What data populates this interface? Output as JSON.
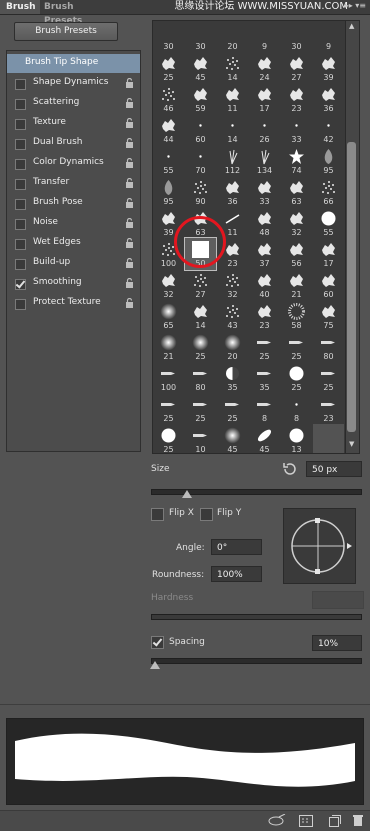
{
  "tabs": {
    "brush": "Brush",
    "brush_presets": "Brush Presets"
  },
  "watermark": "思缘设计论坛 WWW.MISSYUAN.COM",
  "brush_presets_button": "Brush Presets",
  "options": [
    {
      "label": "Brush Tip Shape",
      "selected": true,
      "checkbox": false,
      "checked": false,
      "lock": false
    },
    {
      "label": "Shape Dynamics",
      "checkbox": true,
      "checked": false,
      "lock": true
    },
    {
      "label": "Scattering",
      "checkbox": true,
      "checked": false,
      "lock": true
    },
    {
      "label": "Texture",
      "checkbox": true,
      "checked": false,
      "lock": true
    },
    {
      "label": "Dual Brush",
      "checkbox": true,
      "checked": false,
      "lock": true
    },
    {
      "label": "Color Dynamics",
      "checkbox": true,
      "checked": false,
      "lock": true
    },
    {
      "label": "Transfer",
      "checkbox": true,
      "checked": false,
      "lock": true
    },
    {
      "label": "Brush Pose",
      "checkbox": true,
      "checked": false,
      "lock": true
    },
    {
      "label": "Noise",
      "checkbox": true,
      "checked": false,
      "lock": true
    },
    {
      "label": "Wet Edges",
      "checkbox": true,
      "checked": false,
      "lock": true
    },
    {
      "label": "Build-up",
      "checkbox": true,
      "checked": false,
      "lock": true
    },
    {
      "label": "Smoothing",
      "checkbox": true,
      "checked": true,
      "lock": true
    },
    {
      "label": "Protect Texture",
      "checkbox": true,
      "checked": false,
      "lock": true
    }
  ],
  "tips": [
    {
      "n": "30",
      "s": "none"
    },
    {
      "n": "30",
      "s": "none"
    },
    {
      "n": "20",
      "s": "none"
    },
    {
      "n": "9",
      "s": "none"
    },
    {
      "n": "30",
      "s": "none"
    },
    {
      "n": "9",
      "s": "none"
    },
    {
      "n": "25",
      "s": "splat"
    },
    {
      "n": "45",
      "s": "splat"
    },
    {
      "n": "14",
      "s": "dots"
    },
    {
      "n": "24",
      "s": "splat"
    },
    {
      "n": "27",
      "s": "splat"
    },
    {
      "n": "39",
      "s": "splat"
    },
    {
      "n": "46",
      "s": "dots"
    },
    {
      "n": "59",
      "s": "splat"
    },
    {
      "n": "11",
      "s": "splat"
    },
    {
      "n": "17",
      "s": "splat"
    },
    {
      "n": "23",
      "s": "splat"
    },
    {
      "n": "36",
      "s": "splat"
    },
    {
      "n": "44",
      "s": "splat"
    },
    {
      "n": "60",
      "s": "dot"
    },
    {
      "n": "14",
      "s": "dot"
    },
    {
      "n": "26",
      "s": "dot"
    },
    {
      "n": "33",
      "s": "dot"
    },
    {
      "n": "42",
      "s": "dot"
    },
    {
      "n": "55",
      "s": "dot"
    },
    {
      "n": "70",
      "s": "dot"
    },
    {
      "n": "112",
      "s": "grass"
    },
    {
      "n": "134",
      "s": "grass"
    },
    {
      "n": "74",
      "s": "star"
    },
    {
      "n": "95",
      "s": "leaf"
    },
    {
      "n": "95",
      "s": "leaf"
    },
    {
      "n": "90",
      "s": "dots"
    },
    {
      "n": "36",
      "s": "splat"
    },
    {
      "n": "33",
      "s": "splat"
    },
    {
      "n": "63",
      "s": "splat"
    },
    {
      "n": "66",
      "s": "dots"
    },
    {
      "n": "39",
      "s": "splat"
    },
    {
      "n": "63",
      "s": "splat"
    },
    {
      "n": "11",
      "s": "stroke"
    },
    {
      "n": "48",
      "s": "splat"
    },
    {
      "n": "32",
      "s": "splat"
    },
    {
      "n": "55",
      "s": "circle"
    },
    {
      "n": "100",
      "s": "dots"
    },
    {
      "n": "50",
      "s": "square"
    },
    {
      "n": "23",
      "s": "splat"
    },
    {
      "n": "37",
      "s": "splat"
    },
    {
      "n": "56",
      "s": "splat"
    },
    {
      "n": "17",
      "s": "splat"
    },
    {
      "n": "32",
      "s": "splat"
    },
    {
      "n": "27",
      "s": "dots"
    },
    {
      "n": "32",
      "s": "dots"
    },
    {
      "n": "40",
      "s": "splat"
    },
    {
      "n": "21",
      "s": "splat"
    },
    {
      "n": "60",
      "s": "splat"
    },
    {
      "n": "65",
      "s": "soft"
    },
    {
      "n": "14",
      "s": "splat"
    },
    {
      "n": "43",
      "s": "dots"
    },
    {
      "n": "23",
      "s": "splat"
    },
    {
      "n": "58",
      "s": "texture"
    },
    {
      "n": "75",
      "s": "splat"
    },
    {
      "n": "21",
      "s": "soft"
    },
    {
      "n": "25",
      "s": "soft"
    },
    {
      "n": "20",
      "s": "soft"
    },
    {
      "n": "25",
      "s": "pencil"
    },
    {
      "n": "25",
      "s": "pencil"
    },
    {
      "n": "80",
      "s": "pencil"
    },
    {
      "n": "100",
      "s": "pencil"
    },
    {
      "n": "80",
      "s": "pencil"
    },
    {
      "n": "35",
      "s": "halfcircle"
    },
    {
      "n": "35",
      "s": "pencil"
    },
    {
      "n": "25",
      "s": "circle"
    },
    {
      "n": "25",
      "s": "pencil"
    },
    {
      "n": "25",
      "s": "pencil"
    },
    {
      "n": "25",
      "s": "pencil"
    },
    {
      "n": "25",
      "s": "pencil"
    },
    {
      "n": "8",
      "s": "pencil"
    },
    {
      "n": "8",
      "s": "dot"
    },
    {
      "n": "23",
      "s": "pencil"
    },
    {
      "n": "25",
      "s": "circle"
    },
    {
      "n": "10",
      "s": "pencil"
    },
    {
      "n": "45",
      "s": "soft"
    },
    {
      "n": "45",
      "s": "ellipse"
    },
    {
      "n": "13",
      "s": "circle"
    },
    {
      "n": "",
      "s": "empty"
    }
  ],
  "selected_tip_index": 43,
  "size": {
    "label": "Size",
    "value": "50 px",
    "level": 0.17
  },
  "flip_x": {
    "label": "Flip X",
    "checked": false
  },
  "flip_y": {
    "label": "Flip Y",
    "checked": false
  },
  "angle": {
    "label": "Angle:",
    "value": "0°"
  },
  "roundness": {
    "label": "Roundness:",
    "value": "100%"
  },
  "hardness": {
    "label": "Hardness",
    "value": "",
    "level": 1.0
  },
  "spacing": {
    "label": "Spacing",
    "checked": true,
    "value": "10%",
    "level": 0.02
  },
  "colors": {
    "accent_red": "#e3161f",
    "selected_row": "#7b92a9"
  }
}
